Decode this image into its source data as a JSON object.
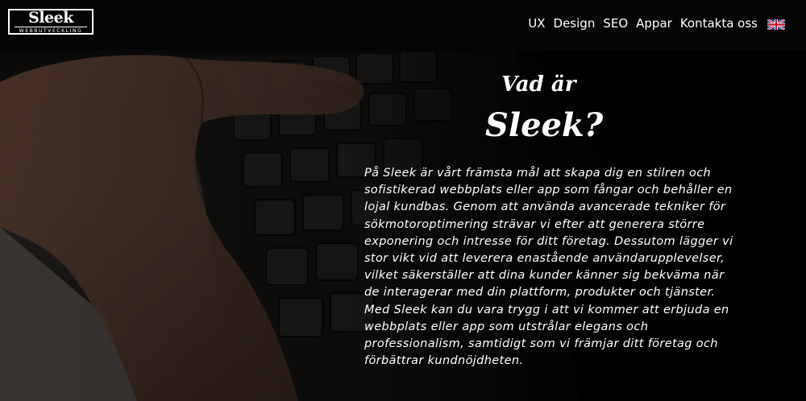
{
  "logo": {
    "word": "Sleek",
    "sub": "WEBBUTVECKLING"
  },
  "nav": {
    "items": [
      "UX",
      "Design",
      "SEO",
      "Appar",
      "Kontakta oss"
    ],
    "flag_icon": "uk-flag-icon"
  },
  "hero": {
    "title_line1": "Vad är",
    "title_line2": "Sleek?",
    "paragraph": "På Sleek är vårt främsta mål att skapa dig en stilren och sofistikerad webbplats eller app som fångar och behåller en lojal kundbas. Genom att använda avancerade tekniker för sökmotoroptimering strävar vi efter att generera större exponering och intresse för ditt företag. Dessutom lägger vi stor vikt vid att leverera enastående användarupplevelser, vilket säkerställer att dina kunder känner sig bekväma när de interagerar med din plattform, produkter och tjänster. Med Sleek kan du vara trygg i att vi kommer att erbjuda en webbplats eller app som utstrålar elegans och professionalism, samtidigt som vi främjar ditt företag och förbättrar kundnöjdheten."
  },
  "colors": {
    "topbar": "#050505",
    "text": "#ffffff"
  }
}
